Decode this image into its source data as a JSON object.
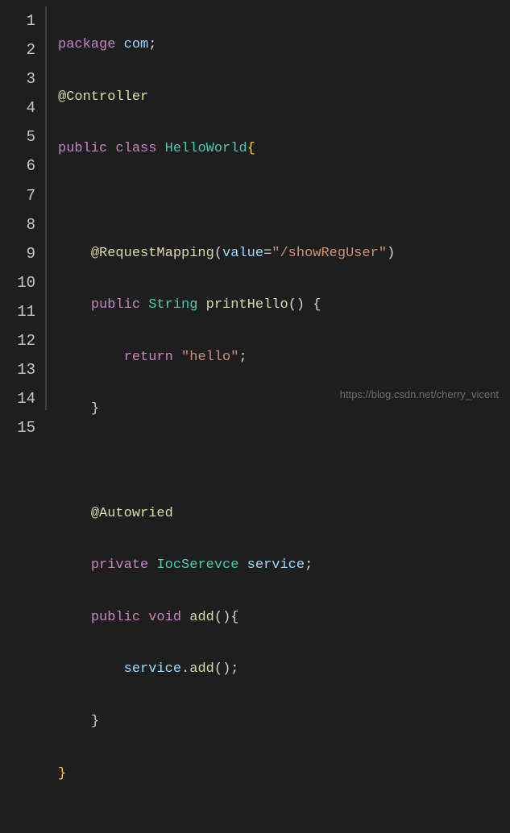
{
  "lines": {
    "n1": "1",
    "n2": "2",
    "n3": "3",
    "n4": "4",
    "n5": "5",
    "n6": "6",
    "n7": "7",
    "n8": "8",
    "n9": "9",
    "n10": "10",
    "n11": "11",
    "n12": "12",
    "n13": "13",
    "n14": "14",
    "n15": "15"
  },
  "tokens": {
    "package": "package",
    "com": "com",
    "semi": ";",
    "at": "@",
    "controller": "Controller",
    "public": "public",
    "class": "class",
    "helloworld": "HelloWorld",
    "lbrace": "{",
    "rbrace": "}",
    "requestmapping": "RequestMapping",
    "lparen": "(",
    "rparen": ")",
    "value": "value",
    "eq": "=",
    "showreguser": "\"/showRegUser\"",
    "string_t": "String",
    "printhello": "printHello",
    "return": "return",
    "hello_str": "\"hello\"",
    "autowried": "Autowried",
    "private": "private",
    "iocserevce": "IocSerevce",
    "service": "service",
    "void": "void",
    "add": "add",
    "dot": "."
  },
  "watermark": "https://blog.csdn.net/cherry_vicent"
}
